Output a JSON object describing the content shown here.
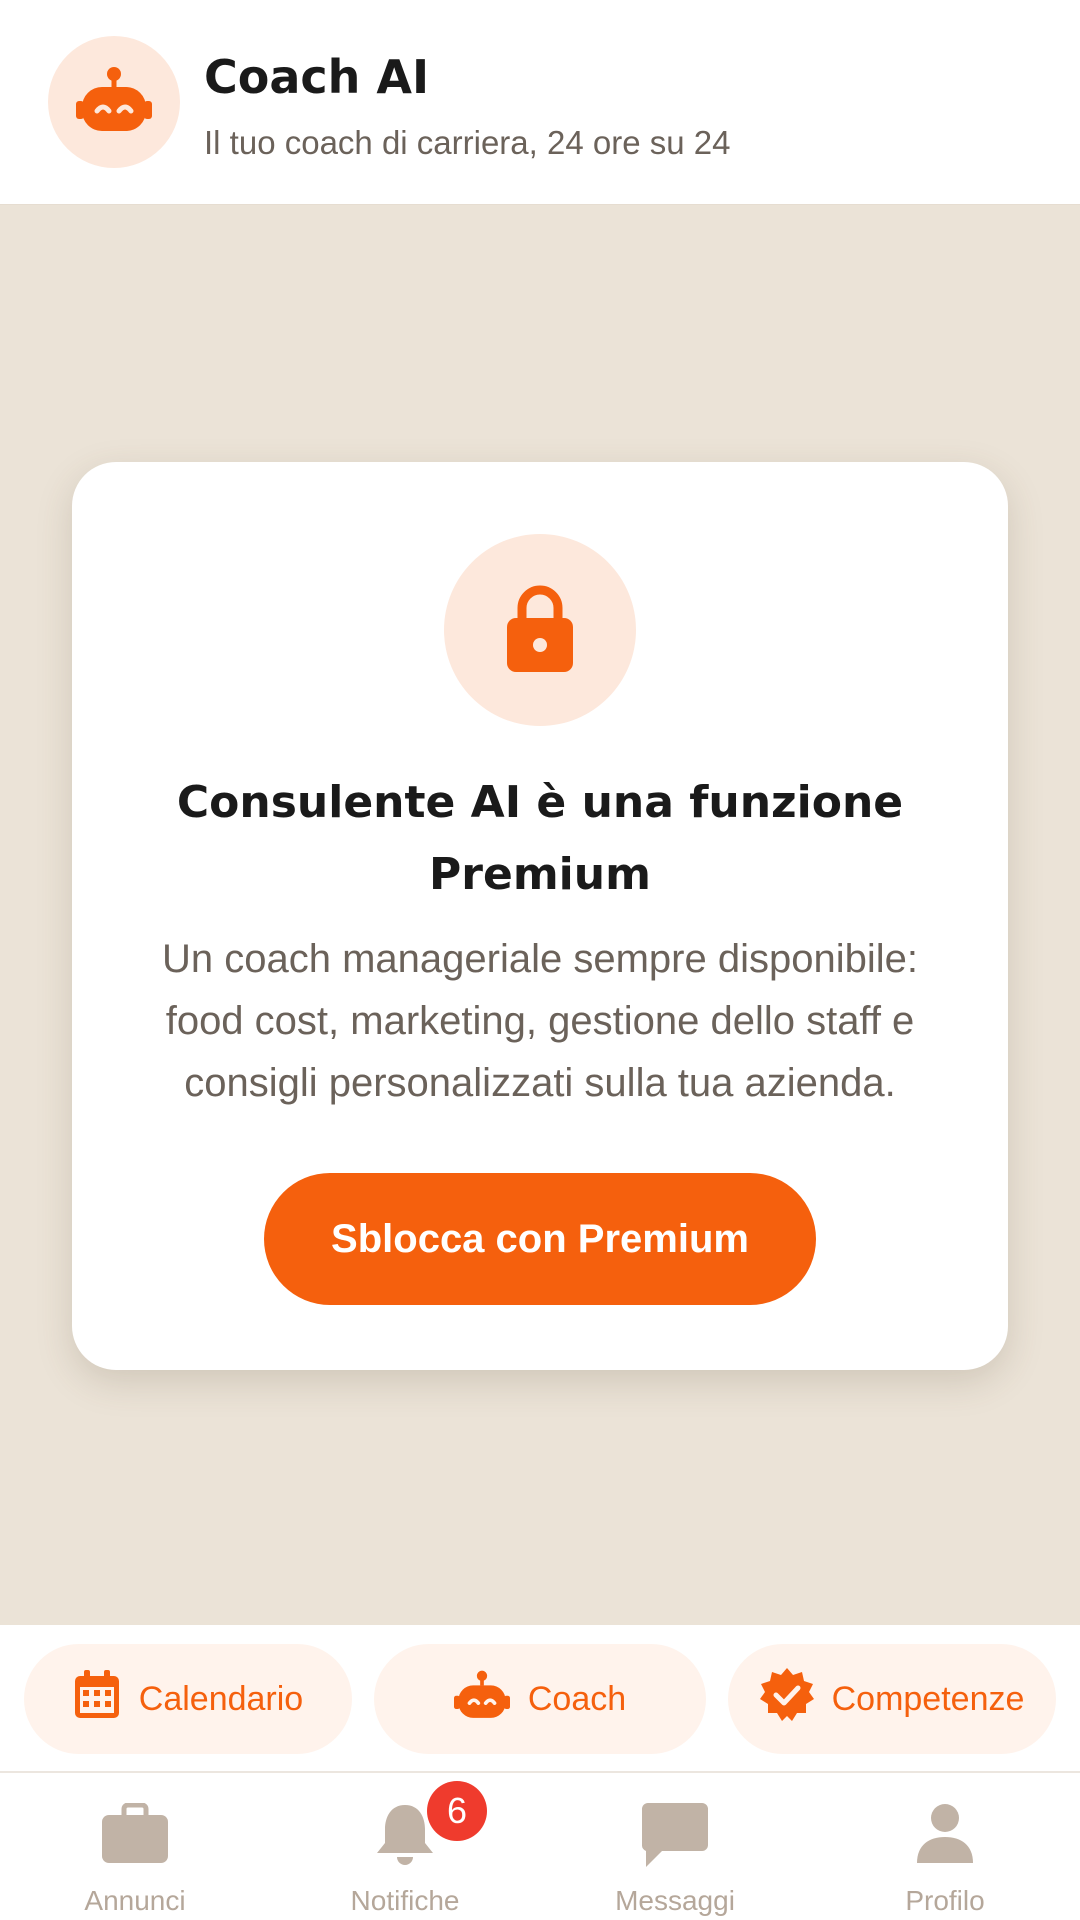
{
  "header": {
    "title": "Coach AI",
    "subtitle": "Il tuo coach di carriera, 24 ore su 24",
    "icon": "robot-icon"
  },
  "card": {
    "icon": "lock-icon",
    "title": "Consulente AI è una funzione Premium",
    "description": "Un coach manageriale sempre disponibile: food cost, marketing, gestione dello staff e consigli personalizzati sulla tua azienda.",
    "button_label": "Sblocca con Premium"
  },
  "quick_actions": [
    {
      "label": "Calendario",
      "icon": "calendar-icon"
    },
    {
      "label": "Coach",
      "icon": "robot-icon"
    },
    {
      "label": "Competenze",
      "icon": "verified-badge-icon"
    }
  ],
  "bottom_nav": [
    {
      "label": "Annunci",
      "icon": "briefcase-icon"
    },
    {
      "label": "Notifiche",
      "icon": "bell-icon",
      "badge": "6"
    },
    {
      "label": "Messaggi",
      "icon": "chat-bubble-icon"
    },
    {
      "label": "Profilo",
      "icon": "person-icon"
    }
  ],
  "colors": {
    "accent": "#f5600d",
    "accent_light": "#fde8dc",
    "background": "#ebe3d7",
    "nav_inactive": "#b5a79a",
    "badge": "#ef3b2d"
  }
}
